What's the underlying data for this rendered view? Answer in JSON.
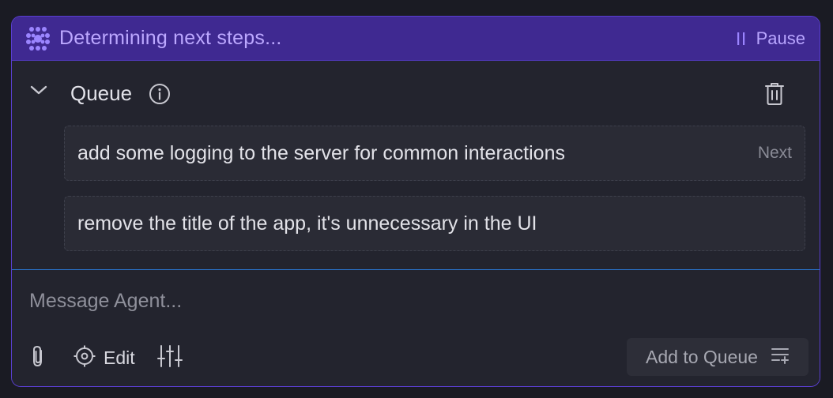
{
  "status": {
    "text": "Determining next steps...",
    "pause_label": "Pause",
    "accent_color": "#3f2991"
  },
  "queue": {
    "title": "Queue",
    "items": [
      {
        "text": "add some logging to the server for common interactions",
        "tag": "Next"
      },
      {
        "text": "remove the title of the app, it's unnecessary in the UI",
        "tag": ""
      }
    ]
  },
  "composer": {
    "placeholder": "Message Agent...",
    "edit_label": "Edit",
    "add_to_queue_label": "Add to Queue",
    "focus_color": "#2a78d6"
  },
  "icons": {
    "status": "agent-dots-icon",
    "pause": "pause-icon",
    "collapse": "chevron-down-icon",
    "info": "info-icon",
    "delete": "trash-icon",
    "attach": "paperclip-icon",
    "edit": "crosshair-icon",
    "settings": "sliders-icon",
    "queue": "add-to-queue-icon"
  }
}
